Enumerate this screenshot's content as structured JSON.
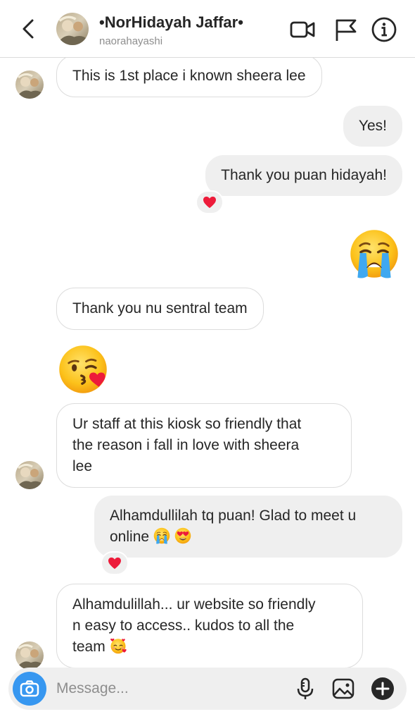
{
  "header": {
    "name": "•NorHidayah Jaffar•",
    "username": "naorahayashi",
    "icons": [
      "back-chevron-icon",
      "video-call-icon",
      "flag-icon",
      "info-icon"
    ]
  },
  "messages": [
    {
      "id": "m1",
      "side": "received",
      "text": "This is 1st place i known sheera lee"
    },
    {
      "id": "m2",
      "side": "sent",
      "text": "Yes!"
    },
    {
      "id": "m3",
      "side": "sent",
      "text": "Thank you puan hidayah!",
      "reaction": "red-heart"
    },
    {
      "id": "m4",
      "side": "sent",
      "emoji": "loudly-crying-face"
    },
    {
      "id": "m5",
      "side": "received",
      "text": "Thank you nu sentral team"
    },
    {
      "id": "m6",
      "side": "received",
      "emoji": "face-blowing-a-kiss"
    },
    {
      "id": "m7",
      "side": "received",
      "text": "Ur staff at this kiosk so friendly that\nthe reason i fall in love with sheera\nlee"
    },
    {
      "id": "m8",
      "side": "sent",
      "text": "Alhamdullilah tq puan! Glad to meet u\nonline",
      "trailing_emojis": [
        "loudly-crying-face",
        "heart-eyes-face"
      ],
      "reaction": "red-heart"
    },
    {
      "id": "m9",
      "side": "received",
      "text": "Alhamdulillah... ur website so friendly\nn easy to access.. kudos to all the\nteam",
      "trailing_emojis": [
        "smiling-face-with-hearts"
      ]
    }
  ],
  "composer": {
    "placeholder": "Message...",
    "icons": [
      "camera-icon",
      "microphone-icon",
      "gallery-icon",
      "plus-icon"
    ]
  },
  "colors": {
    "accent_blue": "#3797f0",
    "sent_bubble": "#efefef",
    "received_border": "#dcdcdc",
    "heart_red": "#ed1b3a"
  }
}
